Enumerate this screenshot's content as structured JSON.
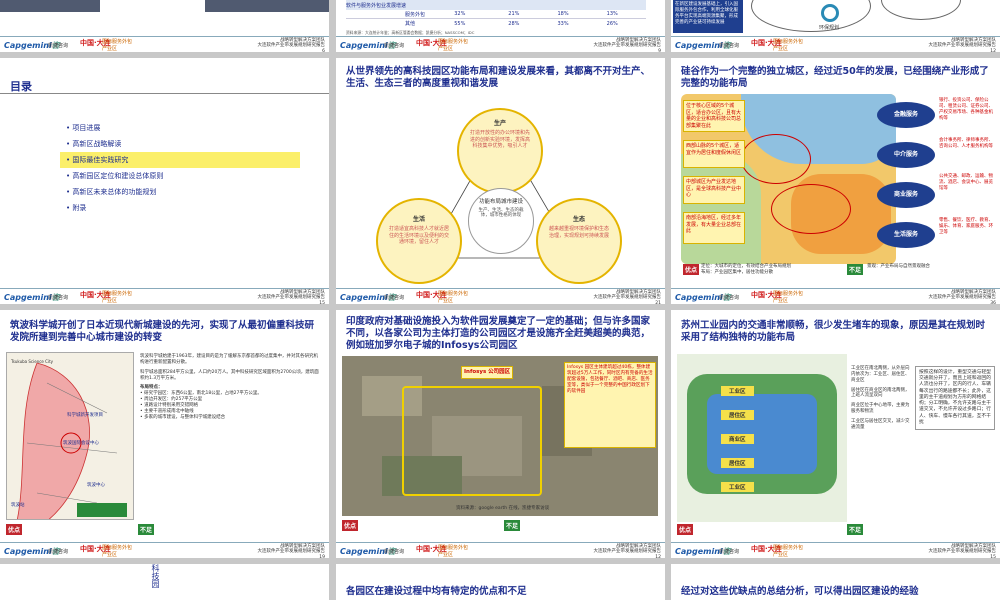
{
  "footer": {
    "brand": "Capgemini",
    "brand_suffix": "咨",
    "partner": "凯捷咨询",
    "logo_cn": "中国·大连",
    "logo_sub": "国际服务外包产业区",
    "right_title": "战略转型解决方案团队",
    "right_sub": "大连软件产业带发展规划研究报告",
    "pages": [
      "6",
      "9",
      "12",
      "15",
      "21",
      "36",
      "19",
      "12",
      "15"
    ]
  },
  "s1": {
    "table_rows": [
      [
        "软件与服务外包业发展增速",
        "",
        ""
      ],
      [
        "",
        "服务外包",
        "32%",
        "21%",
        "18%",
        "13%"
      ],
      [
        "",
        "其他",
        "55%",
        "28%",
        "33%",
        "26%"
      ]
    ],
    "source": "资料来源：大连统计年鉴；高新区管委会数据；凯捷分析；NASSCOM；IDC"
  },
  "s2": {
    "box_text": "在新区建设发展基础上，引入国际服务外包合作，利用全球化服务平台实现高端资源集聚，形成完善的产业链可持续发展",
    "label": "环保规划"
  },
  "s3": {
    "title": "目录",
    "items": [
      "项目进展",
      "高新区战略解读",
      "国际最佳实践研究",
      "高新园区定位和建设总体原则",
      "高新区未来总体的功能规划",
      "附录"
    ],
    "highlight_index": 2
  },
  "s4": {
    "title": "从世界领先的高科技园区功能布局和建设发展来看，其都离不开对生产、生活、生态三者的高度重视和谐发展",
    "top": {
      "head": "生产",
      "body": "打造开放性的办公环境和先进的创新实验环境，发挥高科技集中优势，吸引人才"
    },
    "left": {
      "head": "生活",
      "body": "打造适宜高科技人才就近居住的生活环境以及便利的交通环境，留住人才"
    },
    "right": {
      "head": "生态",
      "body": "越来越重视环境保护和生态治理，实现规划可持续发展"
    },
    "center": {
      "head": "功能布局城市建设",
      "body": "生产、生活、生态的载体，城市性格的体现"
    }
  },
  "s5": {
    "title": "硅谷作为一个完整的独立城区，经过近50年的发展，已经围绕产业形成了完整的功能布局",
    "left_boxes": [
      "位于核心区域的5个城区，适合办公区，且有大量的企业和高科技公司总部集聚在此",
      "西部山脉的5个城区，适宜作为居住和度假休闲区",
      "中部城区为产业发达地区，是全球高科技产业中心",
      "南部沿海地区，经过多年发展，有大量企业总部在此"
    ],
    "ovals": [
      "金融服务",
      "中介服务",
      "商业服务",
      "生活服务"
    ],
    "right_lists": [
      "银行、投资公司、保险公司、租赁公司、证券公司、产权交易市场、各种基金机构等",
      "会计事务所、律师事务所、咨询公司、人才服务机构等",
      "公共交通、邮政、运输、物流、酒店、会议中心、展览馆等",
      "零售、餐饮、医疗、教育、娱乐、体育、家庭服务、环卫等"
    ],
    "merit": "优点",
    "weakness": "不足",
    "notes": [
      "定位：大城市的定位，有效结合产业布局规划",
      "布局：产业园区集中，居住功能分散",
      "景观：产业布局与自然景观融合"
    ]
  },
  "s6": {
    "title": "筑波科学城开创了日本近现代新城建设的先河，实现了从最初偏重科技研发院所建到完善中心城市建设的转变",
    "body": "筑波科学城始建于1963年，建设目的是为了缓解东京都首都的过度集中，并对其各研究机构进行重新配置和分散。",
    "stats": "科学城总面积284平方公里，人口约20万人。其中科技研究区域面积为2700公顷，建筑面积约1.3万平方米。",
    "sections": [
      "布局特点：",
      "研究学园区：东西6公里，南北18公里，占地27平方公里。",
      "周边开发区：约257平方公里",
      "道路设计特别采用交错网格",
      "主要干道形成南北中轴线",
      "多家的城市建设，与整体科学城建设结合"
    ],
    "map_labels": [
      "Tsukuba Science City",
      "科学城新开发项目",
      "筑波国际会议中心",
      "筑波中心",
      "筑波站"
    ],
    "merit": "优点",
    "weakness": "不足"
  },
  "s7": {
    "title": "印度政府对基础设施投入为软件园发展奠定了一定的基础；但与许多国家不同，以各家公司为主体打造的公司园区才是设施齐全赶美超美的典范，例如班加罗尔电子城的Infosys公司园区",
    "label": "Infosys 公司园区",
    "callout": "Infosys 园区主体建筑超过40栋，整体建筑超过5万人工作，同时区内有完备的生活配套设施，包括餐厅、酒吧、商店、医务室等，类似于一个完整的中国行政区划下的软件园",
    "source": "资料来源：google earth 在线，凯捷专家访谈",
    "merit": "优点",
    "weakness": "不足"
  },
  "s8": {
    "title": "苏州工业园内的交通非常顺畅，很少发生堵车的现象，原因是其在规划时采用了结构独特的功能布局",
    "zones": [
      "工业区",
      "居住区",
      "商业区",
      "居住区",
      "工业区"
    ],
    "notes": [
      "工业区在南北两侧，从外层向内依次为：工业区、居住区、商业区",
      "居住区在商业区的南北两侧，上班人流呈双向",
      "商业区位于中心地带，主要为服务和物流",
      "工业区与居住区交叉，减少交通流量"
    ],
    "right_text": "按照这样的设计，重型交通与轻型交通就分开了，而且上班和返回的人流也分开了，区内的行人、车辆每次出行的路途都不长；此外，这里的主干道规划为方形的网格结构；分工明确，不允许支路与主干道交叉，不允许开设过多路口；行人、快车、慢车各行其道，互不干扰",
    "merit": "优点",
    "weakness": "不足"
  },
  "s9": {
    "label": "科技园"
  },
  "s10": {
    "title": "各园区在建设过程中均有特定的优点和不足"
  },
  "s11": {
    "title": "经过对这些优缺点的总结分析，可以得出园区建设的经验"
  }
}
